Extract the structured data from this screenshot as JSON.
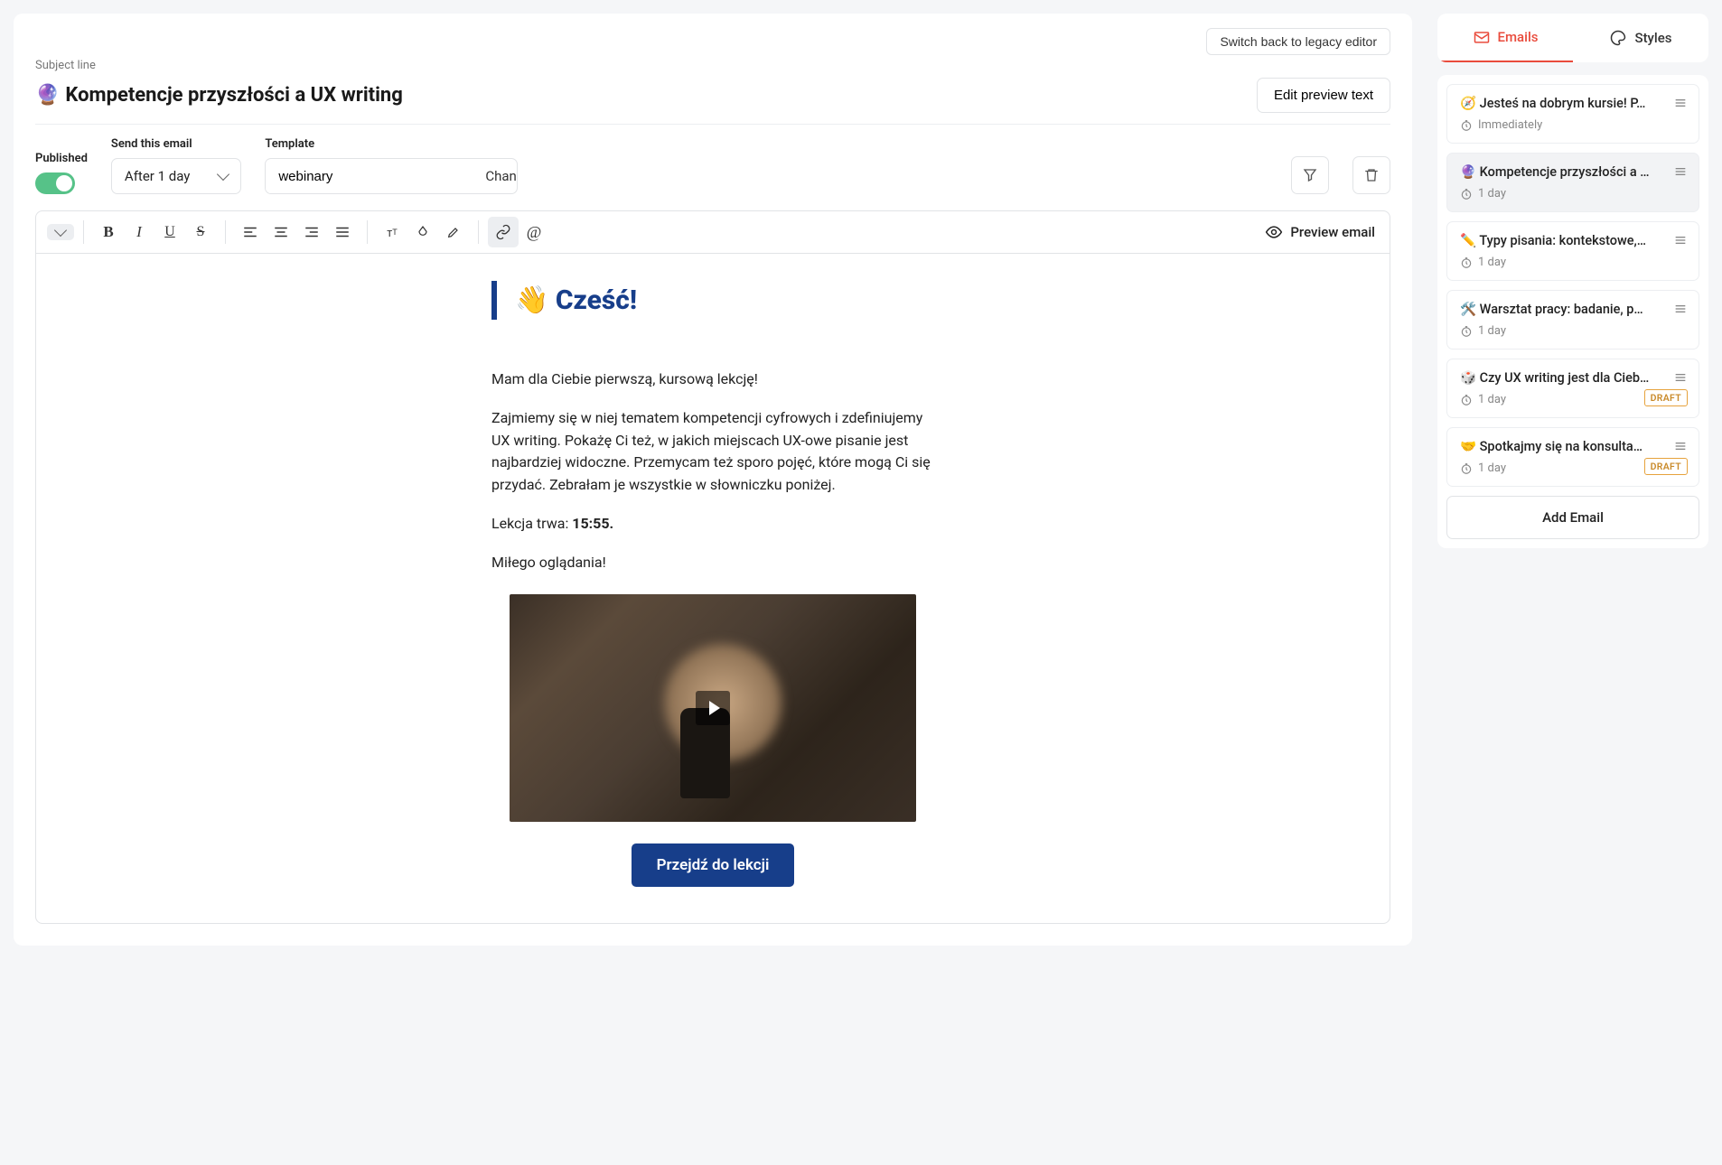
{
  "header": {
    "legacy_label": "Switch back to legacy editor",
    "subject_label": "Subject line",
    "subject_emoji": "🔮",
    "subject_text": "Kompetencje przyszłości a UX writing",
    "edit_preview_label": "Edit preview text"
  },
  "controls": {
    "published_label": "Published",
    "published": true,
    "send_label": "Send this email",
    "send_value": "After 1 day",
    "template_label": "Template",
    "template_value": "webinary",
    "change_label": "Change"
  },
  "toolbar": {
    "preview_label": "Preview email"
  },
  "content": {
    "heading": "👋 Cześć!",
    "p1": "Mam dla Ciebie pierwszą, kursową lekcję!",
    "p2": "Zajmiemy się w niej tematem kompetencji cyfrowych i zdefiniujemy UX writing. Pokażę Ci też, w jakich miejscach UX-owe pisanie jest najbardziej widoczne. Przemycam też sporo pojęć, które mogą Ci się przydać. Zebrałam je wszystkie w słowniczku poniżej.",
    "p3_prefix": "Lekcja trwa: ",
    "p3_bold": "15:55.",
    "p4": "Miłego oglądania!",
    "cta": "Przejdź do lekcji"
  },
  "sidebar": {
    "tabs": {
      "emails": "Emails",
      "styles": "Styles"
    },
    "items": [
      {
        "emoji": "🧭",
        "title": "Jesteś na dobrym kursie! P…",
        "timing": "Immediately",
        "draft": false,
        "active": false
      },
      {
        "emoji": "🔮",
        "title": "Kompetencje przyszłości a …",
        "timing": "1 day",
        "draft": false,
        "active": true
      },
      {
        "emoji": "✏️",
        "title": "Typy pisania: kontekstowe,…",
        "timing": "1 day",
        "draft": false,
        "active": false
      },
      {
        "emoji": "🛠️",
        "title": "Warsztat pracy: badanie, p…",
        "timing": "1 day",
        "draft": false,
        "active": false
      },
      {
        "emoji": "🎲",
        "title": "Czy UX writing jest dla Cieb…",
        "timing": "1 day",
        "draft": true,
        "active": false
      },
      {
        "emoji": "🤝",
        "title": "Spotkajmy się na konsulta…",
        "timing": "1 day",
        "draft": true,
        "active": false
      }
    ],
    "draft_label": "DRAFT",
    "add_label": "Add Email"
  }
}
